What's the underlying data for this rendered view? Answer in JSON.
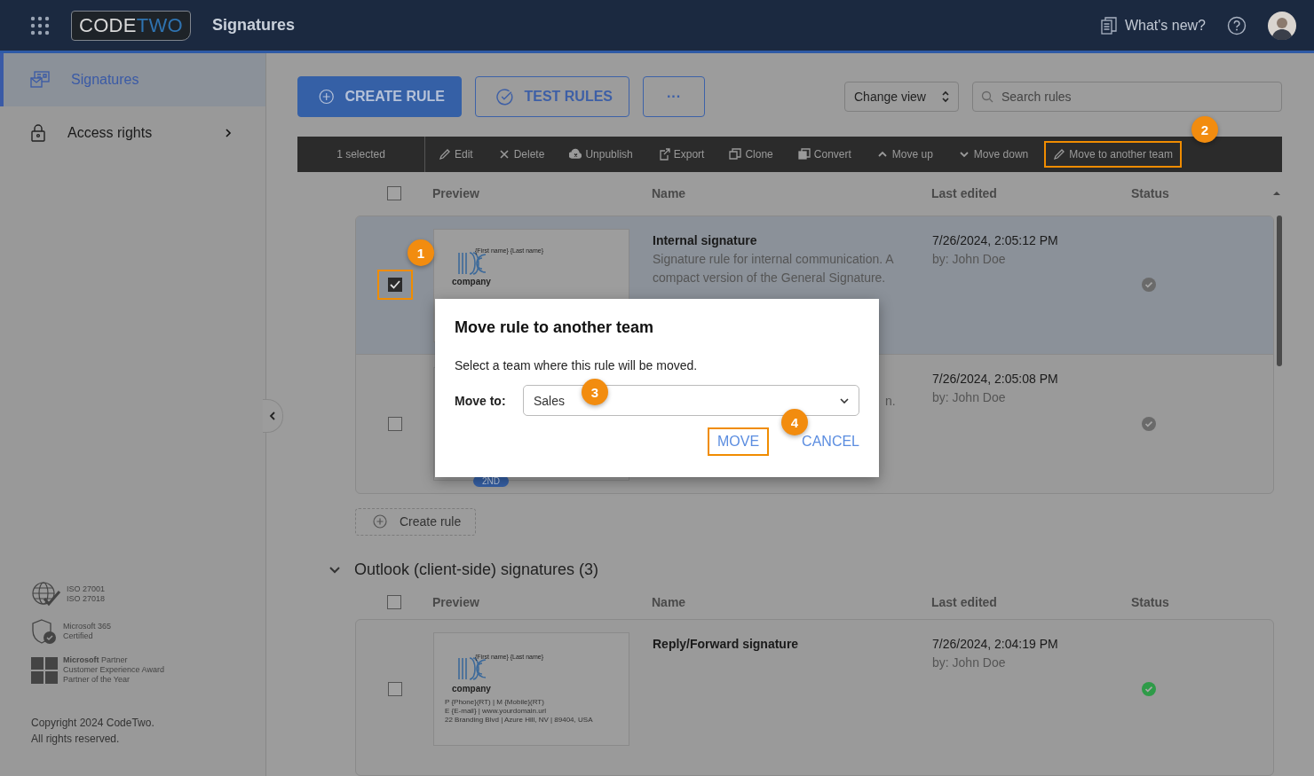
{
  "header": {
    "logo": {
      "first": "CODE",
      "second": "TWO"
    },
    "app_title": "Signatures",
    "whats_new": "What's new?"
  },
  "sidebar": {
    "items": [
      {
        "label": "Signatures",
        "kind": "signatures",
        "selected": true,
        "has_submenu": false
      },
      {
        "label": "Access rights",
        "kind": "lock",
        "selected": false,
        "has_submenu": true
      }
    ],
    "badges": [
      {
        "kind": "globe",
        "lines": [
          "ISO 27001",
          "ISO 27018"
        ]
      },
      {
        "kind": "shield",
        "lines": [
          "Microsoft 365",
          "Certified"
        ]
      },
      {
        "kind": "windows",
        "lines": [
          "**Microsoft** Partner",
          "Customer Experience Award",
          "Partner of the Year"
        ]
      }
    ],
    "copyright": [
      "Copyright 2024 CodeTwo.",
      "All rights reserved."
    ]
  },
  "actions": {
    "create": "CREATE RULE",
    "test": "TEST RULES",
    "more": "···"
  },
  "view_select": {
    "value": "Change view"
  },
  "search": {
    "placeholder": "Search rules"
  },
  "toolbar": {
    "selected_count": "1 selected",
    "items": [
      {
        "label": "Edit",
        "kind": "pencil",
        "highlighted": false
      },
      {
        "label": "Delete",
        "kind": "cross",
        "highlighted": false
      },
      {
        "label": "Unpublish",
        "kind": "cloud",
        "highlighted": false
      },
      {
        "label": "Export",
        "kind": "export",
        "highlighted": false
      },
      {
        "label": "Clone",
        "kind": "clone",
        "highlighted": false
      },
      {
        "label": "Convert",
        "kind": "convert",
        "highlighted": false
      },
      {
        "label": "Move up",
        "kind": "up",
        "highlighted": false
      },
      {
        "label": "Move down",
        "kind": "down",
        "highlighted": false
      },
      {
        "label": "Move to another team",
        "kind": "pencil",
        "highlighted": true
      }
    ]
  },
  "rule_table": {
    "all_checked": false,
    "columns": [
      "Preview",
      "Name",
      "Last edited",
      "Status"
    ],
    "rows": [
      {
        "checked": true,
        "highlighted": true,
        "preview": {
          "name_line": "{First name} {Last name}",
          "company": "company"
        },
        "name": "Internal signature",
        "description": "Signature rule for internal communication. A compact version of the General Signature.",
        "edited": "7/26/2024, 2:05:12 PM",
        "by": "by: John Doe",
        "color": "#6a6a6a"
      },
      {
        "checked": false,
        "highlighted": false,
        "description": "n.",
        "badge": "2ND",
        "edited": "7/26/2024, 2:05:08 PM",
        "by": "by: John Doe",
        "color": "#6a6a6a"
      }
    ],
    "create_link": "Create rule"
  },
  "outlook_section": {
    "title": "Outlook (client-side) signatures (3)",
    "expanded": true,
    "all_checked": false,
    "columns": [
      "Preview",
      "Name",
      "Last edited",
      "Status"
    ],
    "rows": [
      {
        "checked": false,
        "highlighted": false,
        "preview": {
          "name_line": "{First name} {Last name}",
          "company": "company",
          "lines": [
            "P {Phone}(RT) | M {Mobile}(RT)",
            "E {E-mail} | www.yourdomain.url",
            "22 Branding Blvd | Azure Hill, NV | 89404, USA"
          ]
        },
        "name": "Reply/Forward signature",
        "edited": "7/26/2024, 2:04:19 PM",
        "by": "by: John Doe",
        "color": "#2e9b48"
      }
    ]
  },
  "dialog": {
    "title": "Move rule to another team",
    "text": "Select a team where this rule will be moved.",
    "field_label": "Move to:",
    "value": "Sales",
    "buttons": [
      {
        "label": "MOVE",
        "highlighted": true
      },
      {
        "label": "CANCEL",
        "highlighted": false
      }
    ]
  },
  "annotations": [
    {
      "label": "1"
    },
    {
      "label": "2"
    },
    {
      "label": "3"
    },
    {
      "label": "4"
    }
  ]
}
